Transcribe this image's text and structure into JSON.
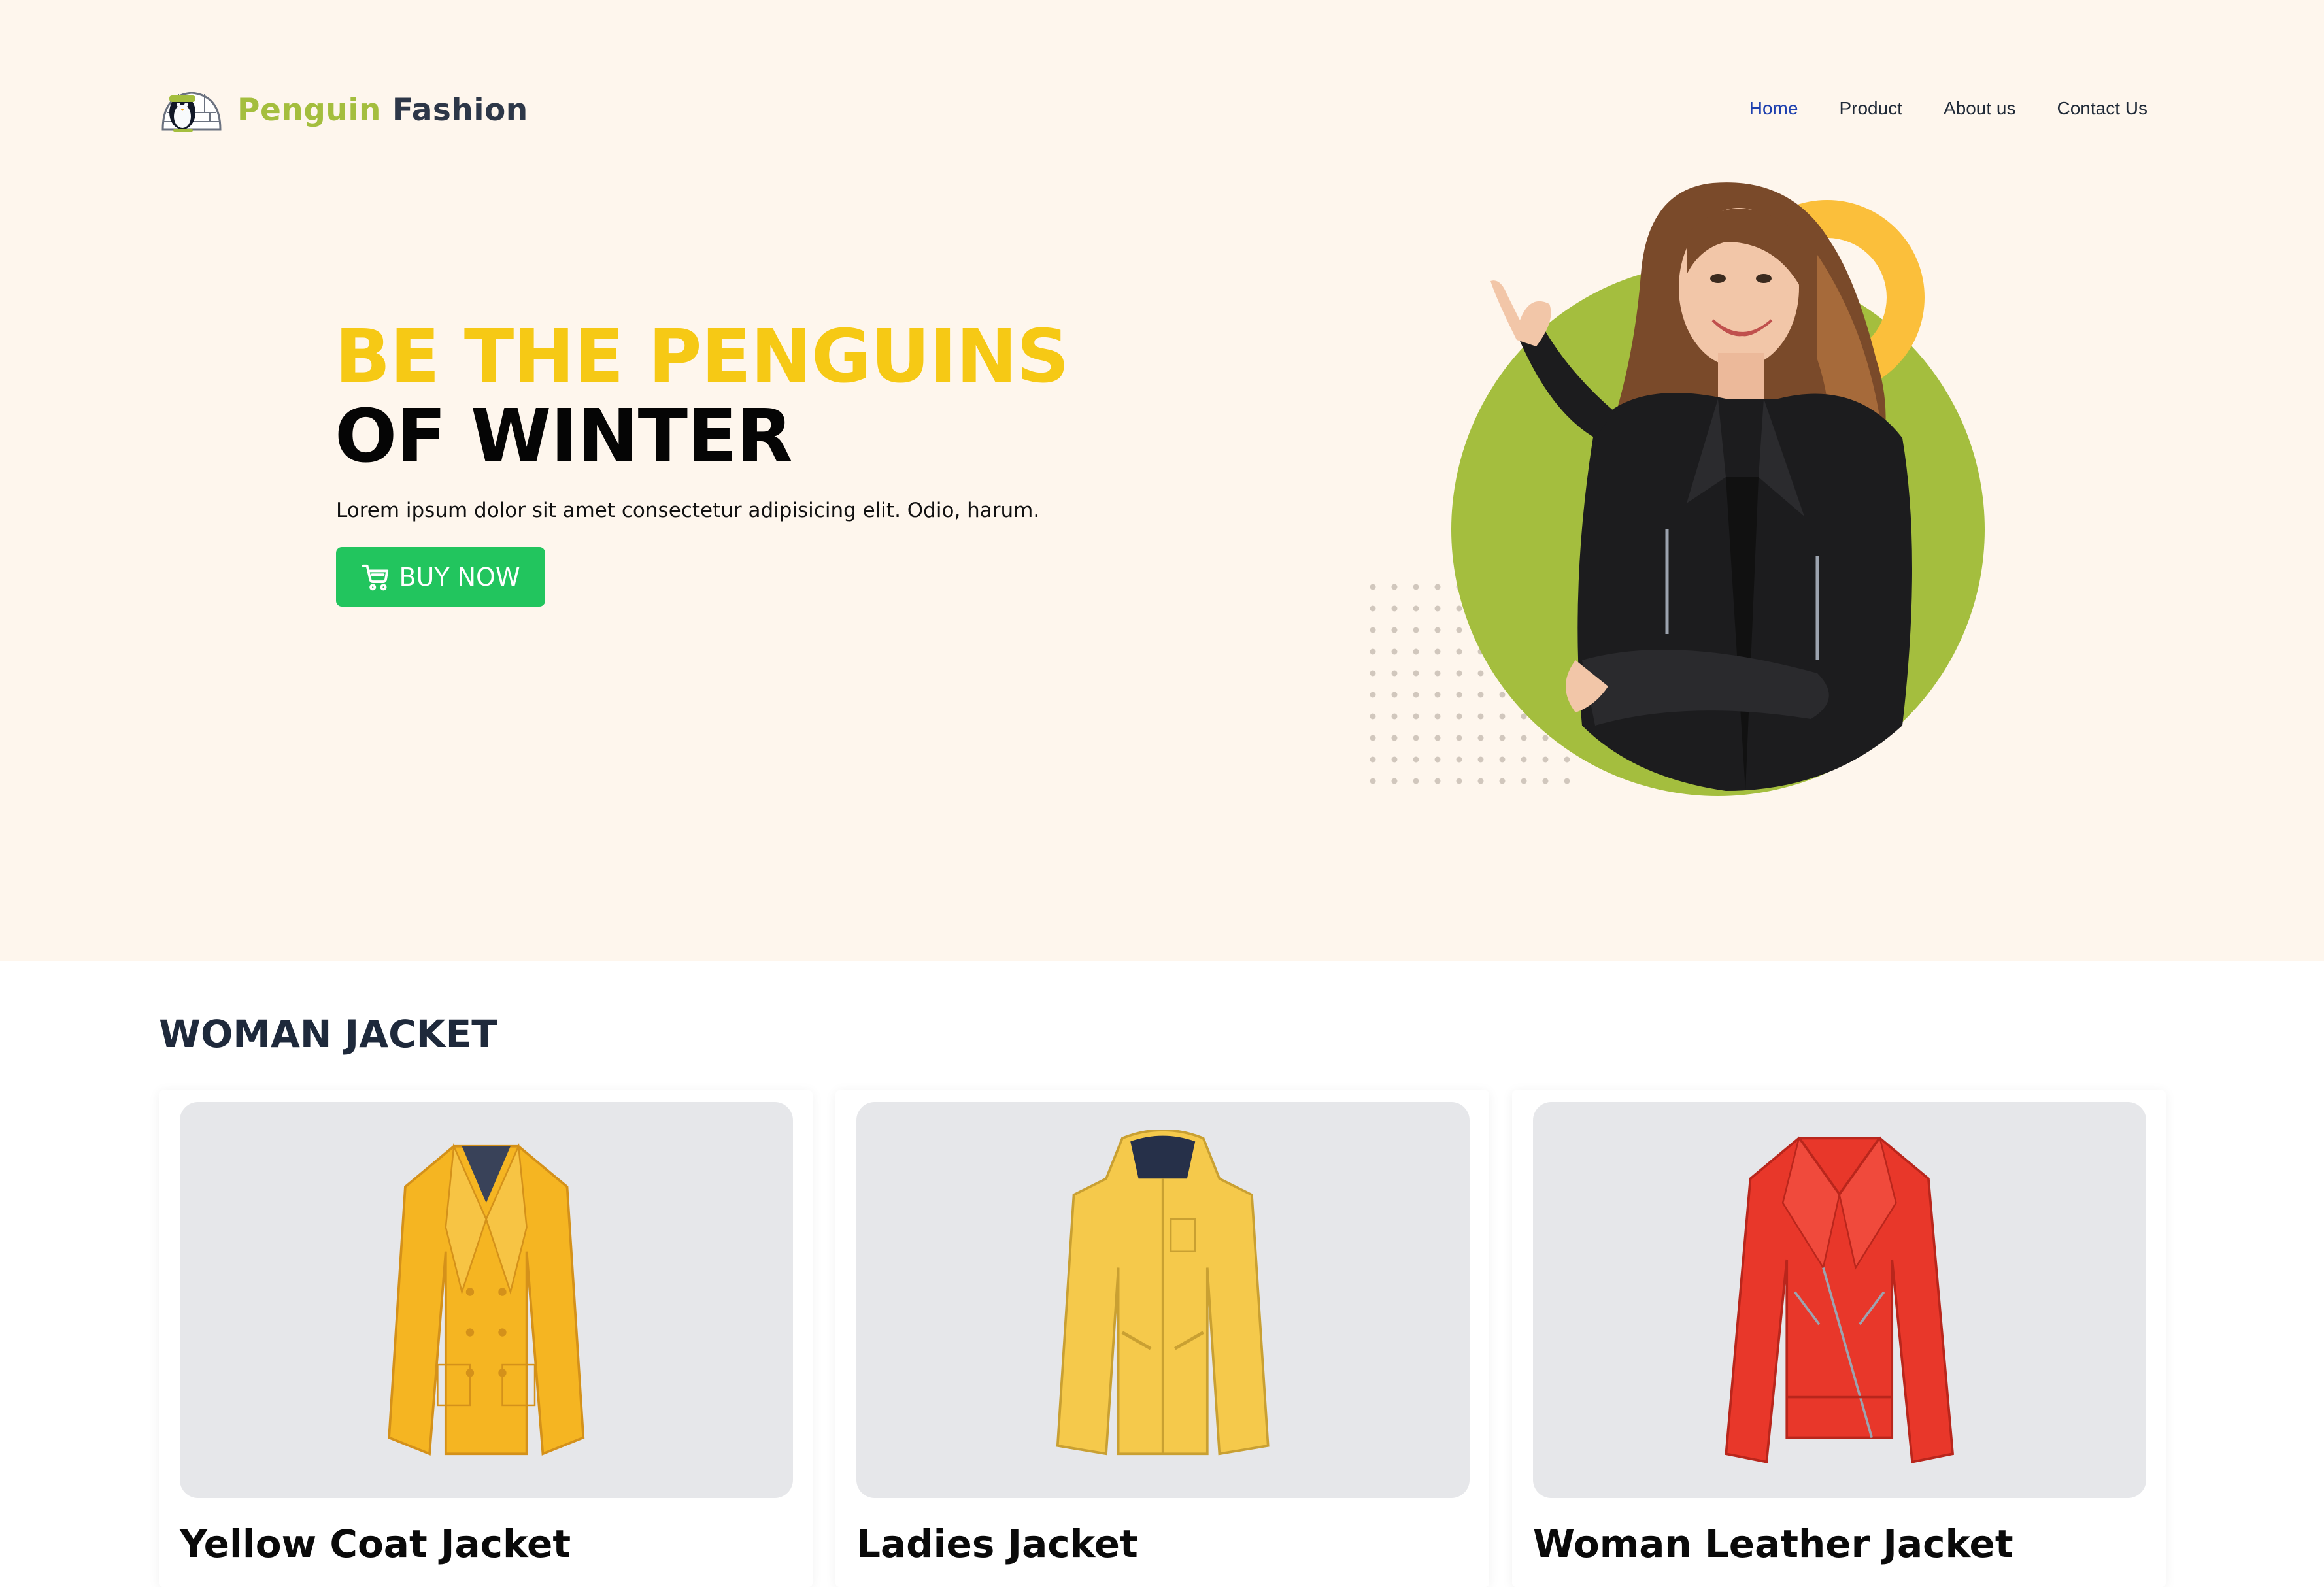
{
  "brand": {
    "name_part1": "Penguin",
    "name_part2": "Fashion",
    "logo_icon": "igloo-penguin-icon",
    "color_part1": "#a4be3e",
    "color_part2": "#2d3748"
  },
  "nav": {
    "items": [
      {
        "label": "Home",
        "active": true
      },
      {
        "label": "Product",
        "active": false
      },
      {
        "label": "About us",
        "active": false
      },
      {
        "label": "Contact Us",
        "active": false
      }
    ],
    "active_color": "#1e40af"
  },
  "hero": {
    "headline_line1": "BE THE PENGUINS",
    "headline_line2": "OF WINTER",
    "subtitle": "Lorem ipsum dolor sit amet consectetur adipisicing elit. Odio, harum.",
    "cta_label": "BUY NOW",
    "cta_icon": "shopping-cart-icon",
    "colors": {
      "background": "#fef6ed",
      "headline_accent": "#f6c915",
      "cta": "#22c55e",
      "circle": "#a4be3e",
      "ring": "#fbbf3b"
    }
  },
  "products_section": {
    "title": "WOMAN JACKET",
    "items": [
      {
        "name": "Yellow Coat Jacket",
        "image": "yellow-coat-jacket-image"
      },
      {
        "name": "Ladies Jacket",
        "image": "ladies-hooded-jacket-image"
      },
      {
        "name": "Woman Leather Jacket",
        "image": "red-leather-jacket-image"
      }
    ]
  }
}
